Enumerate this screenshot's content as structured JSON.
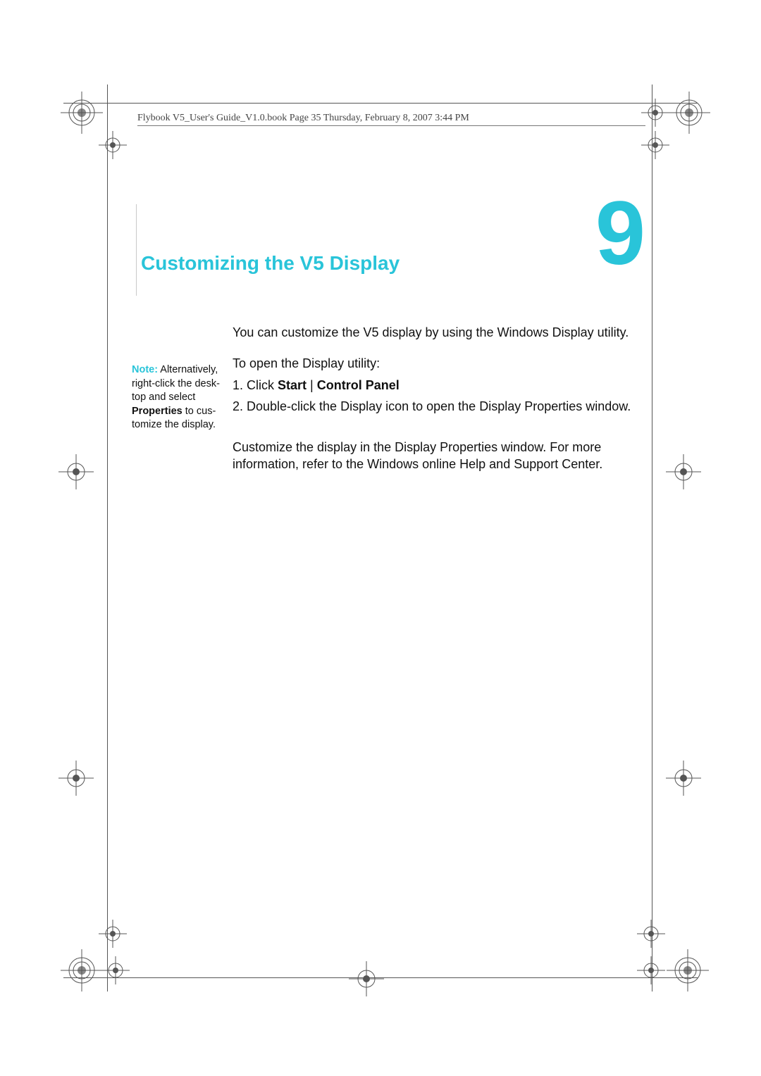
{
  "header": {
    "running_head": "Flybook V5_User's Guide_V1.0.book  Page 35  Thursday, February 8, 2007  3:44 PM"
  },
  "chapter": {
    "number": "9",
    "title": "Customizing the V5 Display"
  },
  "content": {
    "p_intro": "You can customize the V5 display by using the Windows Display utility.",
    "p_open": "To open the Display utility:",
    "step1_prefix": "1. Click ",
    "step1_bold_a": "Start",
    "step1_mid": " | ",
    "step1_bold_b": "Control Panel",
    "step2": "2. Double-click the Display icon to open the Display Proper­ties window.",
    "p_more": "Customize the display in the Display Properties window. For more information, refer to the Windows online Help and Support Center."
  },
  "note": {
    "label": "Note:",
    "t1": " Alternatively, right-click the desk­top and select ",
    "bold": "Properties",
    "t2": " to cus­tomize the display."
  }
}
